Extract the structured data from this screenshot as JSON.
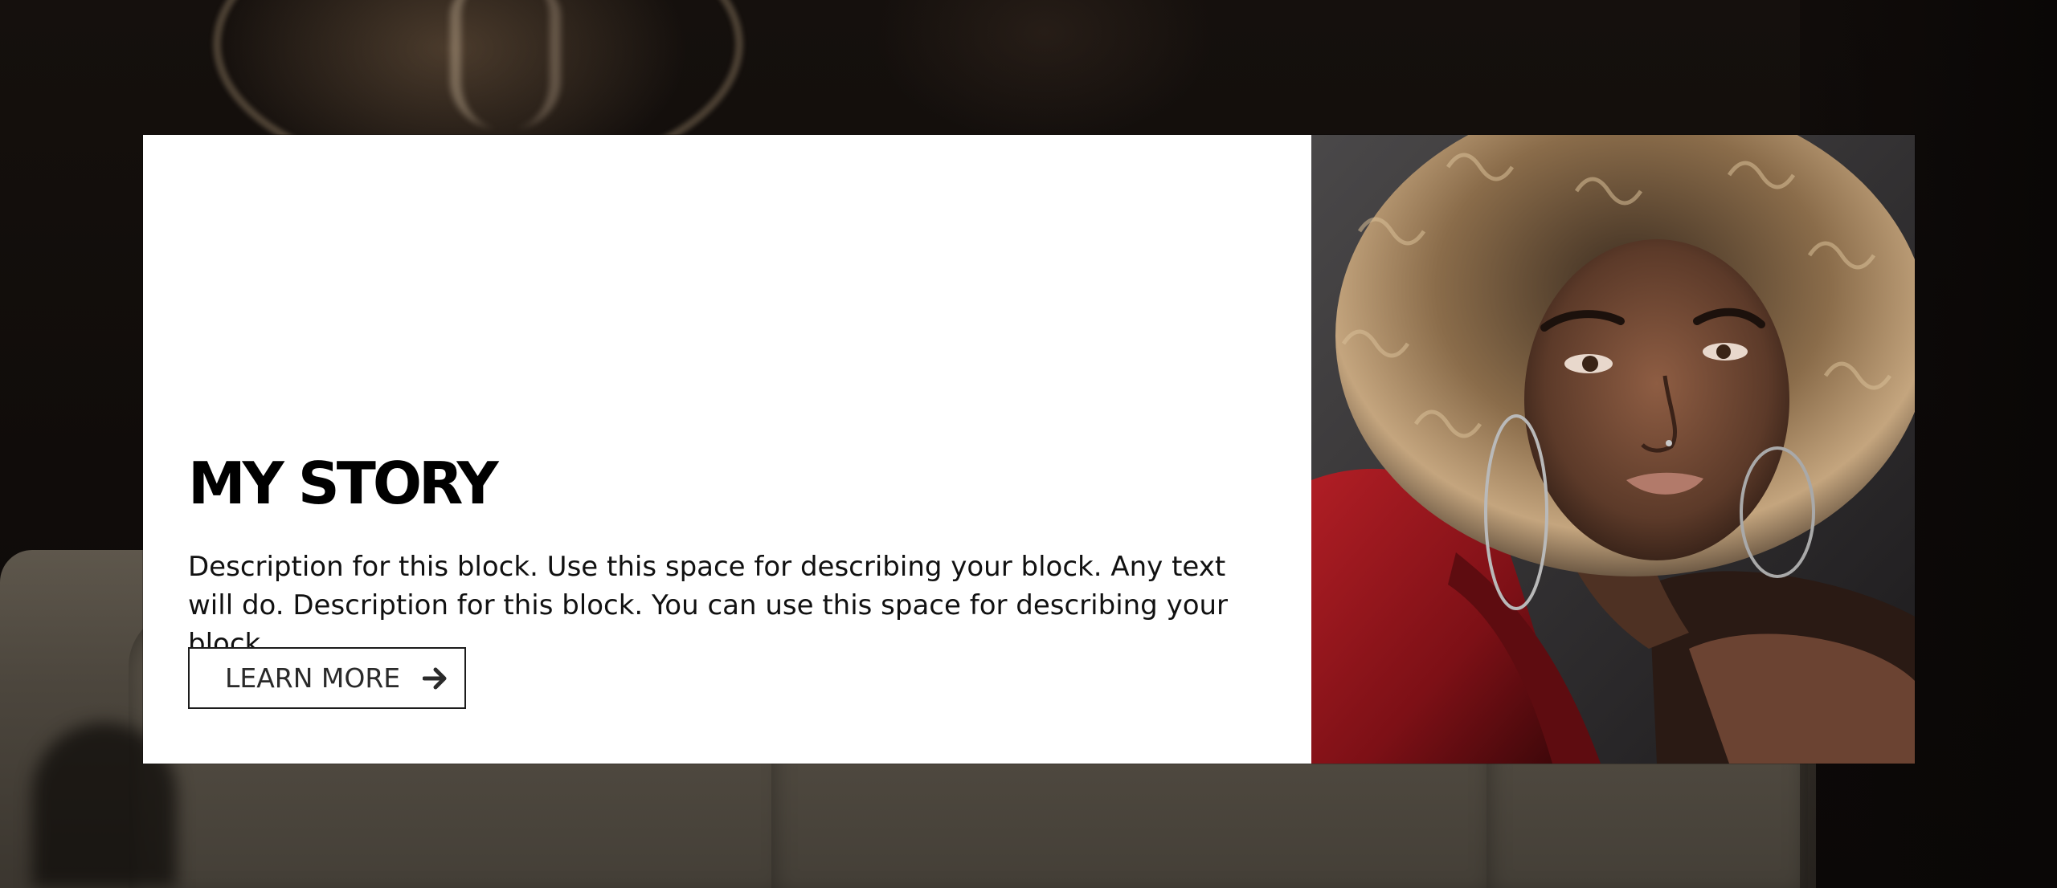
{
  "block": {
    "title": "MY STORY",
    "description": "Description for this block. Use this space for describing your block. Any text will do. Description for this block. You can use this space for describing your block.",
    "button_label": "LEARN MORE",
    "button_icon": "arrow-right-icon"
  },
  "colors": {
    "card_background": "#ffffff",
    "title": "#000000",
    "text": "#111111",
    "button_border": "#1c1c1c",
    "page_background": "#0d0a08"
  }
}
